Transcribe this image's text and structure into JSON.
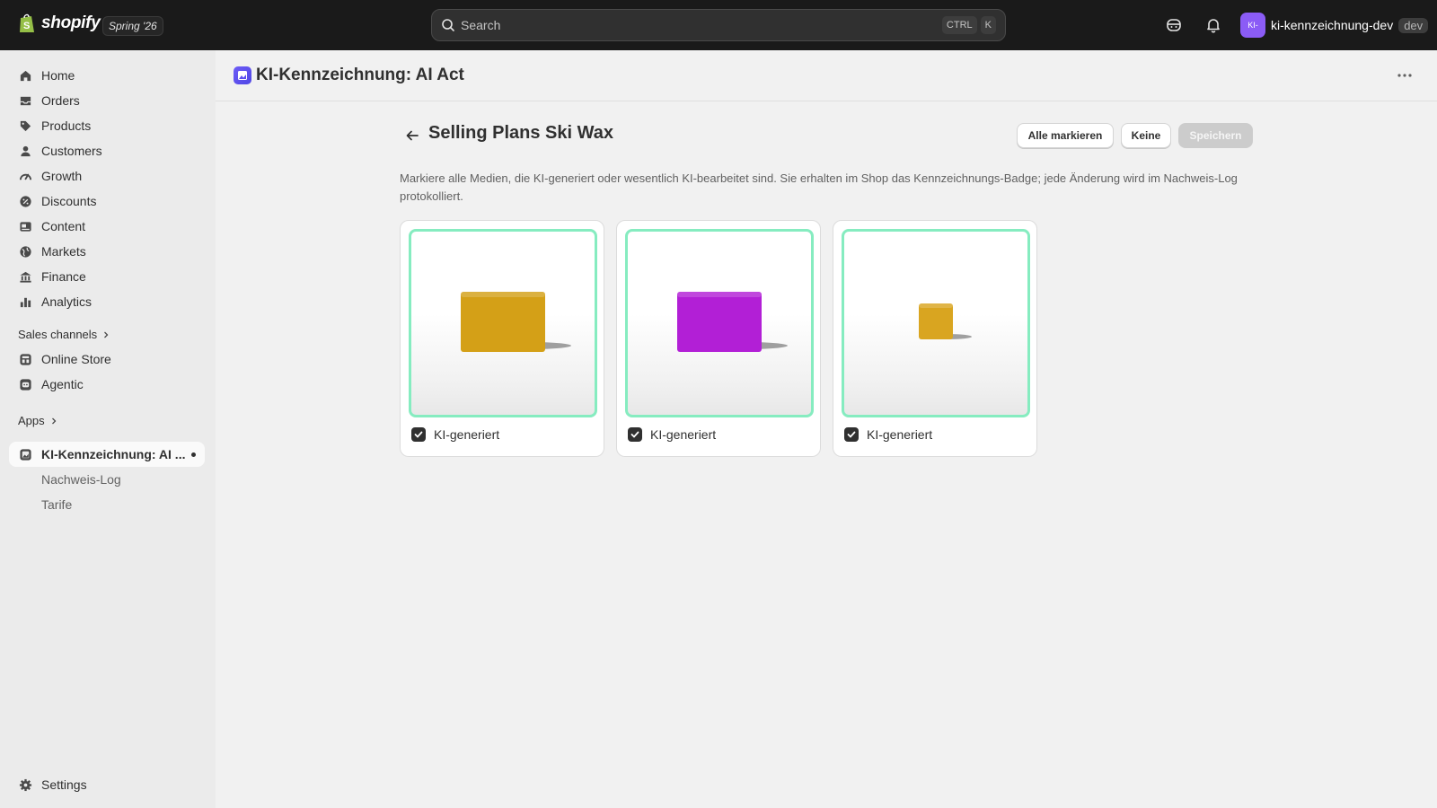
{
  "topbar": {
    "brand": "shopify",
    "release": "Spring '26",
    "search": {
      "placeholder": "Search",
      "shortcut_mod": "CTRL",
      "shortcut_key": "K"
    },
    "store": {
      "avatar": "KI-",
      "name": "ki-kennzeichnung-dev",
      "env": "dev"
    }
  },
  "sidebar": {
    "items": [
      {
        "label": "Home",
        "icon": "home-icon"
      },
      {
        "label": "Orders",
        "icon": "inbox-icon"
      },
      {
        "label": "Products",
        "icon": "tag-icon"
      },
      {
        "label": "Customers",
        "icon": "person-icon"
      },
      {
        "label": "Growth",
        "icon": "gauge-icon"
      },
      {
        "label": "Discounts",
        "icon": "discount-icon"
      },
      {
        "label": "Content",
        "icon": "content-icon"
      },
      {
        "label": "Markets",
        "icon": "globe-icon"
      },
      {
        "label": "Finance",
        "icon": "bank-icon"
      },
      {
        "label": "Analytics",
        "icon": "bar-chart-icon"
      }
    ],
    "sales_channels_label": "Sales channels",
    "channels": [
      {
        "label": "Online Store",
        "icon": "store-icon"
      },
      {
        "label": "Agentic",
        "icon": "agentic-icon"
      }
    ],
    "apps_label": "Apps",
    "app": {
      "label": "KI-Kennzeichnung: AI ...",
      "sub": [
        "Nachweis-Log",
        "Tarife"
      ]
    },
    "settings_label": "Settings"
  },
  "app_header": {
    "title": "KI-Kennzeichnung: AI Act"
  },
  "page": {
    "title": "Selling Plans Ski Wax",
    "actions": {
      "select_all": "Alle markieren",
      "none": "Keine",
      "save": "Speichern"
    },
    "description": "Markiere alle Medien, die KI-generiert oder wesentlich KI-bearbeitet sind. Sie erhalten im Shop das Kennzeichnungs-Badge; jede Änderung wird im Nachweis-Log protokolliert.",
    "media": [
      {
        "label": "KI-generiert",
        "checked": true,
        "color": "#d4a017"
      },
      {
        "label": "KI-generiert",
        "checked": true,
        "color": "#b21fd6"
      },
      {
        "label": "KI-generiert",
        "checked": true,
        "color": "#d9a520"
      }
    ]
  },
  "colors": {
    "accent_border": "#86ecc0",
    "topbar_bg": "#1a1a1a",
    "sidebar_bg": "#ebebeb"
  }
}
